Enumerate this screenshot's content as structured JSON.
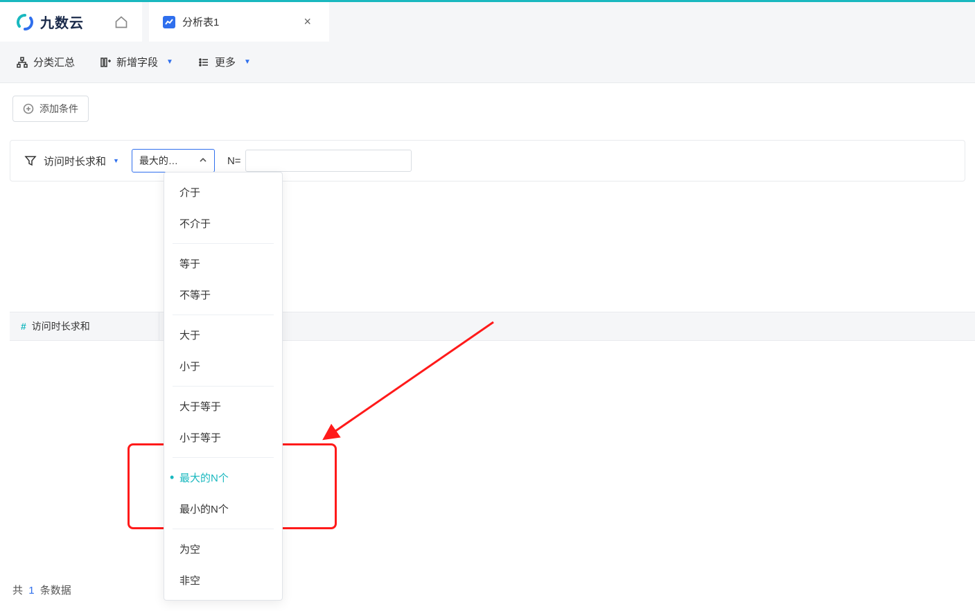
{
  "brand": "九数云",
  "tab": {
    "title": "分析表1",
    "close": "×"
  },
  "toolbar": {
    "group_summary": "分类汇总",
    "add_field": "新增字段",
    "more": "更多"
  },
  "chip": {
    "add_condition": "添加条件"
  },
  "filter": {
    "field_name": "访问时长求和",
    "operator_display": "最大的…",
    "n_label": "N=",
    "n_value": ""
  },
  "dropdown": {
    "groups": [
      [
        "介于",
        "不介于"
      ],
      [
        "等于",
        "不等于"
      ],
      [
        "大于",
        "小于"
      ],
      [
        "大于等于",
        "小于等于"
      ],
      [
        "最大的N个",
        "最小的N个"
      ],
      [
        "为空",
        "非空"
      ]
    ],
    "selected": "最大的N个"
  },
  "column": {
    "name": "访问时长求和"
  },
  "footer": {
    "prefix": "共",
    "count": "1",
    "suffix": "条数据"
  }
}
